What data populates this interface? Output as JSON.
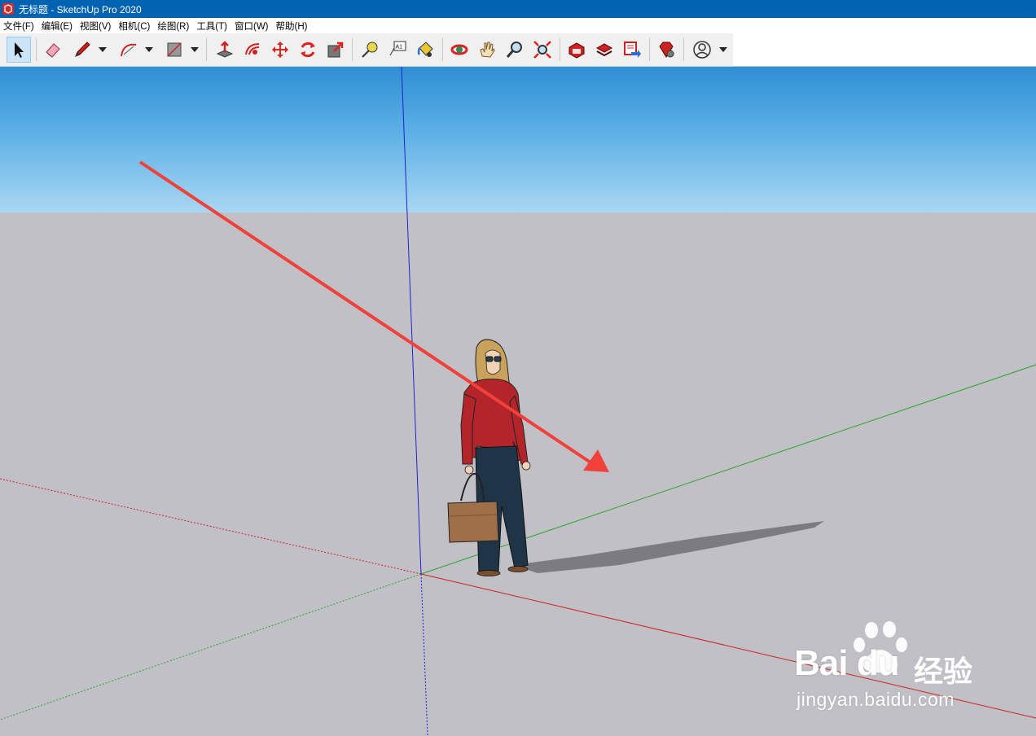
{
  "window": {
    "title": "无标题 - SketchUp Pro 2020",
    "app_icon": "sketchup-logo-icon"
  },
  "menu": {
    "items": [
      "文件(F)",
      "编辑(E)",
      "视图(V)",
      "相机(C)",
      "绘图(R)",
      "工具(T)",
      "窗口(W)",
      "帮助(H)"
    ]
  },
  "toolbar": {
    "tools": [
      {
        "name": "select-tool-icon",
        "active": true
      },
      {
        "name": "eraser-tool-icon"
      },
      {
        "name": "pencil-line-tool-icon",
        "dropdown": true
      },
      {
        "name": "arc-tool-icon",
        "dropdown": true
      },
      {
        "name": "rectangle-tool-icon",
        "dropdown": true
      },
      {
        "name": "push-pull-tool-icon"
      },
      {
        "name": "offset-tool-icon"
      },
      {
        "name": "move-tool-icon"
      },
      {
        "name": "rotate-tool-icon"
      },
      {
        "name": "scale-tool-icon"
      },
      {
        "name": "tape-measure-tool-icon"
      },
      {
        "name": "text-tool-icon"
      },
      {
        "name": "paint-bucket-tool-icon"
      },
      {
        "name": "orbit-tool-icon"
      },
      {
        "name": "pan-tool-icon"
      },
      {
        "name": "zoom-tool-icon"
      },
      {
        "name": "zoom-extents-tool-icon"
      },
      {
        "name": "3d-warehouse-icon"
      },
      {
        "name": "extension-warehouse-icon"
      },
      {
        "name": "send-to-layout-icon"
      },
      {
        "name": "extension-manager-icon"
      },
      {
        "name": "user-account-icon",
        "dropdown": true
      }
    ],
    "text_tool_label": "A1"
  },
  "watermark": {
    "brand": "Bai du",
    "suffix": "经验",
    "url": "jingyan.baidu.com"
  },
  "colors": {
    "titlebar": "#0063b1",
    "sky_top": "#2f8fd3",
    "ground": "#c0c0c6",
    "arrow": "#f0413a",
    "axis_red": "#d02020",
    "axis_green": "#2aa52a",
    "axis_blue": "#2020d0"
  }
}
